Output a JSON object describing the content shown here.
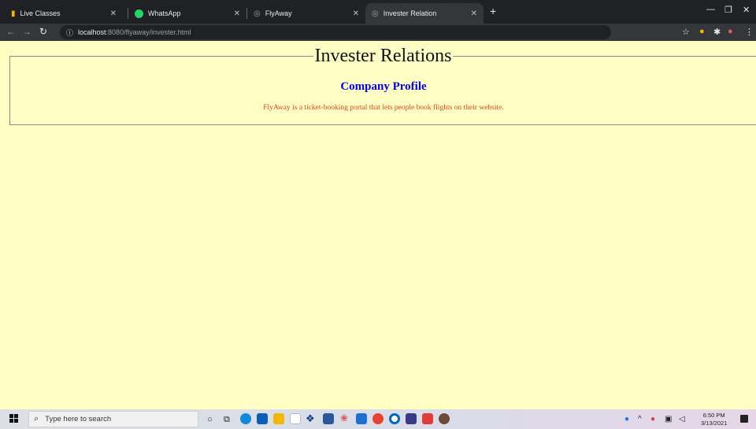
{
  "browser": {
    "tabs": [
      {
        "title": "Live Classes",
        "icon": "live-classes-icon",
        "color": "#f4b400"
      },
      {
        "title": "WhatsApp",
        "icon": "whatsapp-icon",
        "color": "#25d366"
      },
      {
        "title": "FlyAway",
        "icon": "globe-icon",
        "color": "#9aa0a6"
      },
      {
        "title": "Invester Relation",
        "icon": "globe-icon",
        "color": "#9aa0a6",
        "active": true
      }
    ],
    "url_host": "localhost",
    "url_path": ":8080/flyaway/invester.html"
  },
  "page": {
    "legend": "Invester Relations",
    "profile_title": "Company Profile",
    "profile_text": "FlyAway is a ticket-booking portal that lets people book flights on their website.",
    "background": "#ffffc4",
    "title_color": "#0000ee",
    "text_color": "#e04020"
  },
  "taskbar": {
    "search_placeholder": "Type here to search",
    "time": "6:50 PM",
    "date": "3/13/2021"
  }
}
